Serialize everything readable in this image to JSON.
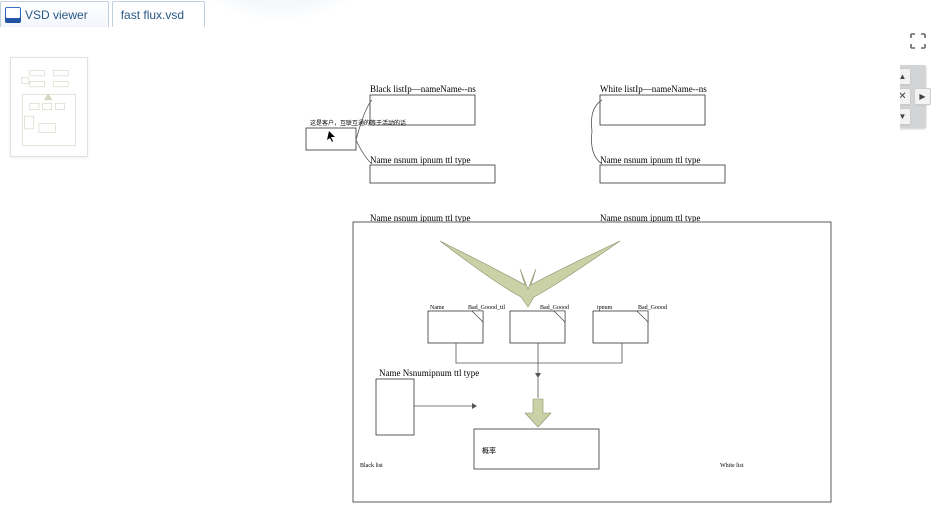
{
  "tabs": {
    "app_label": "VSD viewer",
    "file_label": "fast flux.vsd"
  },
  "nav": {
    "zoom_in": "+",
    "zoom_out": "−",
    "up": "▲",
    "left": "◀",
    "reset": "✕",
    "right": "▶",
    "down": "▼"
  },
  "diagram": {
    "black_title": "Black listIp—nameName--ns",
    "white_title": "White listIp—nameName--ns",
    "cn_note": "这是客户，互联互通的等于活动的话",
    "mid_left": "Name nsnum ipnum ttl type",
    "mid_right": "Name nsnum ipnum ttl type",
    "bot_left": "Name nsnum ipnum ttl type",
    "bot_right": "Name nsnum ipnum ttl type",
    "name": "Name",
    "bad_good_ttl": "Bad_Goood_ttl",
    "bad_good": "Bad_Goood",
    "ipnum": "ipnum",
    "result_title": "Name Nsnumipnum ttl type",
    "prob": "概率",
    "black": "Black list",
    "white": "White list"
  }
}
